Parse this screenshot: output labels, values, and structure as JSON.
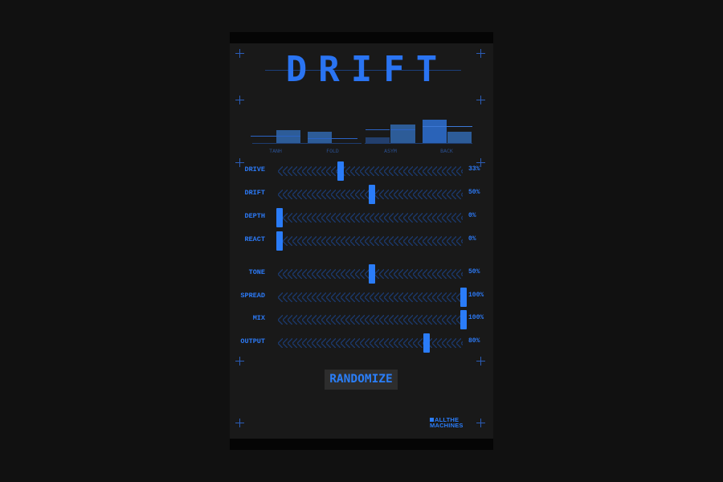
{
  "title": "DRIFT",
  "shaper": {
    "modes": [
      {
        "label": "TANH"
      },
      {
        "label": "FOLD"
      },
      {
        "label": "ASYM"
      },
      {
        "label": "BACK"
      }
    ]
  },
  "controls_group_1": [
    {
      "label": "DRIVE",
      "value": 33,
      "display": "33%"
    },
    {
      "label": "DRIFT",
      "value": 50,
      "display": "50%"
    },
    {
      "label": "DEPTH",
      "value": 0,
      "display": "0%"
    },
    {
      "label": "REACT",
      "value": 0,
      "display": "0%"
    }
  ],
  "controls_group_2": [
    {
      "label": "TONE",
      "value": 50,
      "display": "50%"
    },
    {
      "label": "SPREAD",
      "value": 100,
      "display": "100%"
    },
    {
      "label": "MIX",
      "value": 100,
      "display": "100%"
    },
    {
      "label": "OUTPUT",
      "value": 80,
      "display": "80%"
    }
  ],
  "randomize_label": "RANDOMIZE",
  "brand": {
    "line1": "ALLTHE",
    "line2": "MACHINES"
  },
  "colors": {
    "accent": "#2a7cf8",
    "panel": "#191919",
    "background": "#111111"
  }
}
